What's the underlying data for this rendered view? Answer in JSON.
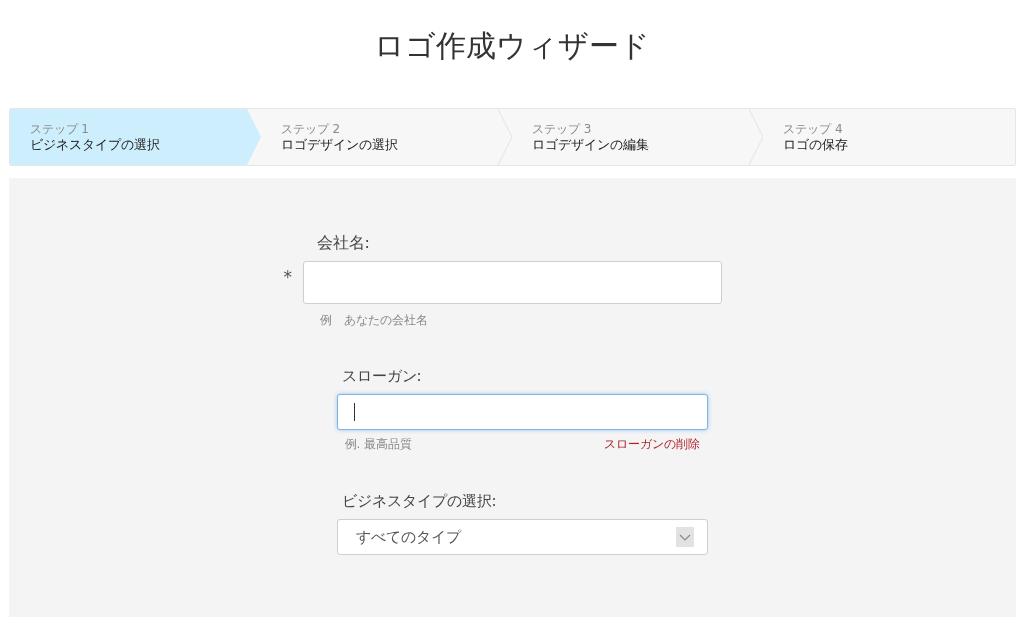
{
  "title": "ロゴ作成ウィザード",
  "steps": [
    {
      "number": "ステップ 1",
      "label": "ビジネスタイプの選択",
      "selected": true
    },
    {
      "number": "ステップ 2",
      "label": "ロゴデザインの選択",
      "selected": false
    },
    {
      "number": "ステップ 3",
      "label": "ロゴデザインの編集",
      "selected": false
    },
    {
      "number": "ステップ 4",
      "label": "ロゴの保存",
      "selected": false
    }
  ],
  "company": {
    "label": "会社名:",
    "required_mark": "*",
    "focused": false,
    "hint": "例　あなたの会社名"
  },
  "slogan": {
    "label": "スローガン:",
    "focused": true,
    "hint": "例. 最高品質",
    "remove_link": "スローガンの削除"
  },
  "business_type": {
    "label": "ビジネスタイプの選択:",
    "value": "すべてのタイプ"
  }
}
